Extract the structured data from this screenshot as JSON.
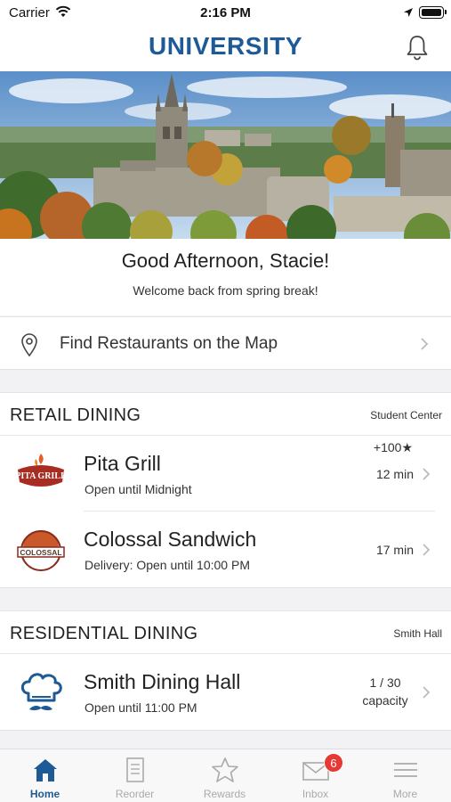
{
  "status_bar": {
    "carrier": "Carrier",
    "time": "2:16 PM"
  },
  "header": {
    "title": "UNIVERSITY"
  },
  "greeting": {
    "title": "Good Afternoon, Stacie!",
    "subtitle": "Welcome back from spring break!"
  },
  "map_row": {
    "label": "Find Restaurants on the Map"
  },
  "retail": {
    "title": "RETAIL DINING",
    "location": "Student Center",
    "items": [
      {
        "name": "Pita Grill",
        "status": "Open until Midnight",
        "eta": "12 min",
        "bonus": "+100★",
        "logo_text": "PITA GRILL"
      },
      {
        "name": "Colossal Sandwich",
        "status": "Delivery: Open until 10:00 PM",
        "eta": "17 min",
        "logo_text": "COLOSSAL"
      }
    ]
  },
  "residential": {
    "title": "RESIDENTIAL DINING",
    "location": "Smith Hall",
    "items": [
      {
        "name": "Smith Dining Hall",
        "status": "Open until 11:00 PM",
        "capacity": "1 / 30",
        "capacity_label": "capacity"
      }
    ]
  },
  "tabbar": {
    "tabs": [
      {
        "label": "Home",
        "icon": "home-icon",
        "active": true
      },
      {
        "label": "Reorder",
        "icon": "receipt-icon"
      },
      {
        "label": "Rewards",
        "icon": "star-icon"
      },
      {
        "label": "Inbox",
        "icon": "mail-icon",
        "badge": "6"
      },
      {
        "label": "More",
        "icon": "menu-icon"
      }
    ]
  },
  "colors": {
    "brand": "#1e5a96",
    "badge": "#e53935"
  }
}
